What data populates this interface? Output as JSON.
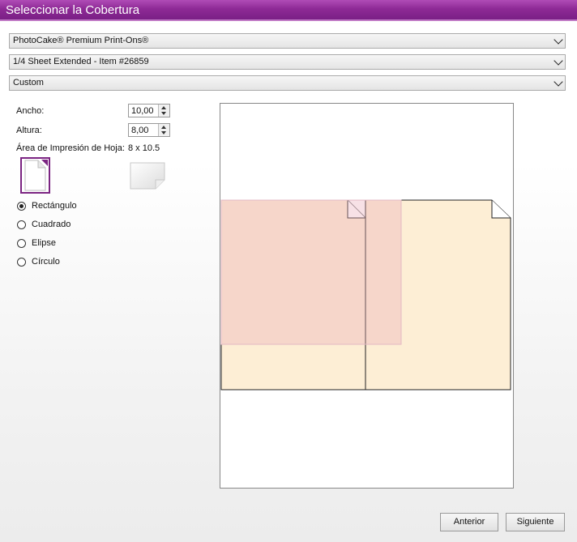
{
  "window": {
    "title": "Seleccionar la Cobertura"
  },
  "dropdowns": {
    "product": "PhotoCake® Premium Print-Ons®",
    "sheet": "1/4 Sheet Extended - Item #26859",
    "size": "Custom"
  },
  "fields": {
    "width_label": "Ancho:",
    "width_value": "10,00",
    "height_label": "Altura:",
    "height_value": "8,00",
    "print_area_label": "Área de Impresión de Hoja:",
    "print_area_value": "8 x 10.5"
  },
  "orientation": {
    "selected": "portrait"
  },
  "shapes": [
    {
      "label": "Rectángulo",
      "selected": true
    },
    {
      "label": "Cuadrado",
      "selected": false
    },
    {
      "label": "Elipse",
      "selected": false
    },
    {
      "label": "Círculo",
      "selected": false
    }
  ],
  "colors": {
    "accent": "#7b2482",
    "sheet_fill": "#fdeed5",
    "coverage_fill": "#f0c8c4"
  },
  "buttons": {
    "back": "Anterior",
    "next": "Siguiente"
  }
}
